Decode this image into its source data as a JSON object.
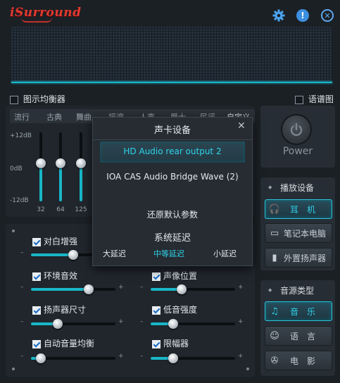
{
  "app": {
    "logo": "iSurround"
  },
  "titlebar": {
    "settings_icon": "gear-icon",
    "info_icon": "info-icon",
    "close_icon": "close-icon"
  },
  "toggles": {
    "show_eq": "图示均衡器",
    "spectrum": "语谱图"
  },
  "presets": [
    "流行",
    "古典",
    "舞曲",
    "摇滚",
    "人声",
    "爵士",
    "民谣",
    "自定义"
  ],
  "eq": {
    "db_labels": [
      "+12dB",
      "0dB",
      "-12dB"
    ],
    "bands": [
      {
        "freq": "32",
        "level": 0.55
      },
      {
        "freq": "64",
        "level": 0.55
      },
      {
        "freq": "125",
        "level": 0.55
      }
    ]
  },
  "power": {
    "label": "Power"
  },
  "dialog": {
    "title": "声卡设备",
    "devices": [
      "HD Audio rear output 2",
      "IOA CAS Audio Bridge Wave (2)"
    ],
    "selected": "HD Audio rear output 2",
    "reset": "还原默认参数",
    "latency_title": "系统延迟",
    "latency_options": [
      "大延迟",
      "中等延迟",
      "小延迟"
    ],
    "latency_selected": "中等延迟"
  },
  "effects": [
    {
      "label": "对白增强",
      "checked": true,
      "value": 0.6
    },
    {
      "label": "环境音效",
      "checked": true,
      "value": 0.68
    },
    {
      "label": "声像位置",
      "checked": true,
      "value": 0.37
    },
    {
      "label": "扬声器尺寸",
      "checked": true,
      "value": 0.32
    },
    {
      "label": "低音强度",
      "checked": true,
      "value": 0.27
    },
    {
      "label": "自动音量均衡",
      "checked": true,
      "value": 0.12
    },
    {
      "label": "限幅器",
      "checked": true,
      "value": 0.27
    }
  ],
  "playback": {
    "title": "播放设备",
    "items": [
      {
        "label": "耳　机",
        "icon": "headphones-icon",
        "active": true
      },
      {
        "label": "笔记本电脑",
        "icon": "laptop-icon",
        "active": false
      },
      {
        "label": "外置扬声器",
        "icon": "speaker-icon",
        "active": false
      }
    ]
  },
  "source": {
    "title": "音源类型",
    "items": [
      {
        "label": "音　乐",
        "icon": "music-note-icon",
        "active": true
      },
      {
        "label": "语　言",
        "icon": "speech-icon",
        "active": false
      },
      {
        "label": "电　影",
        "icon": "film-reel-icon",
        "active": false
      }
    ]
  },
  "colors": {
    "accent": "#19b6c8",
    "logo": "#e23a30",
    "background": "#1b2025"
  }
}
